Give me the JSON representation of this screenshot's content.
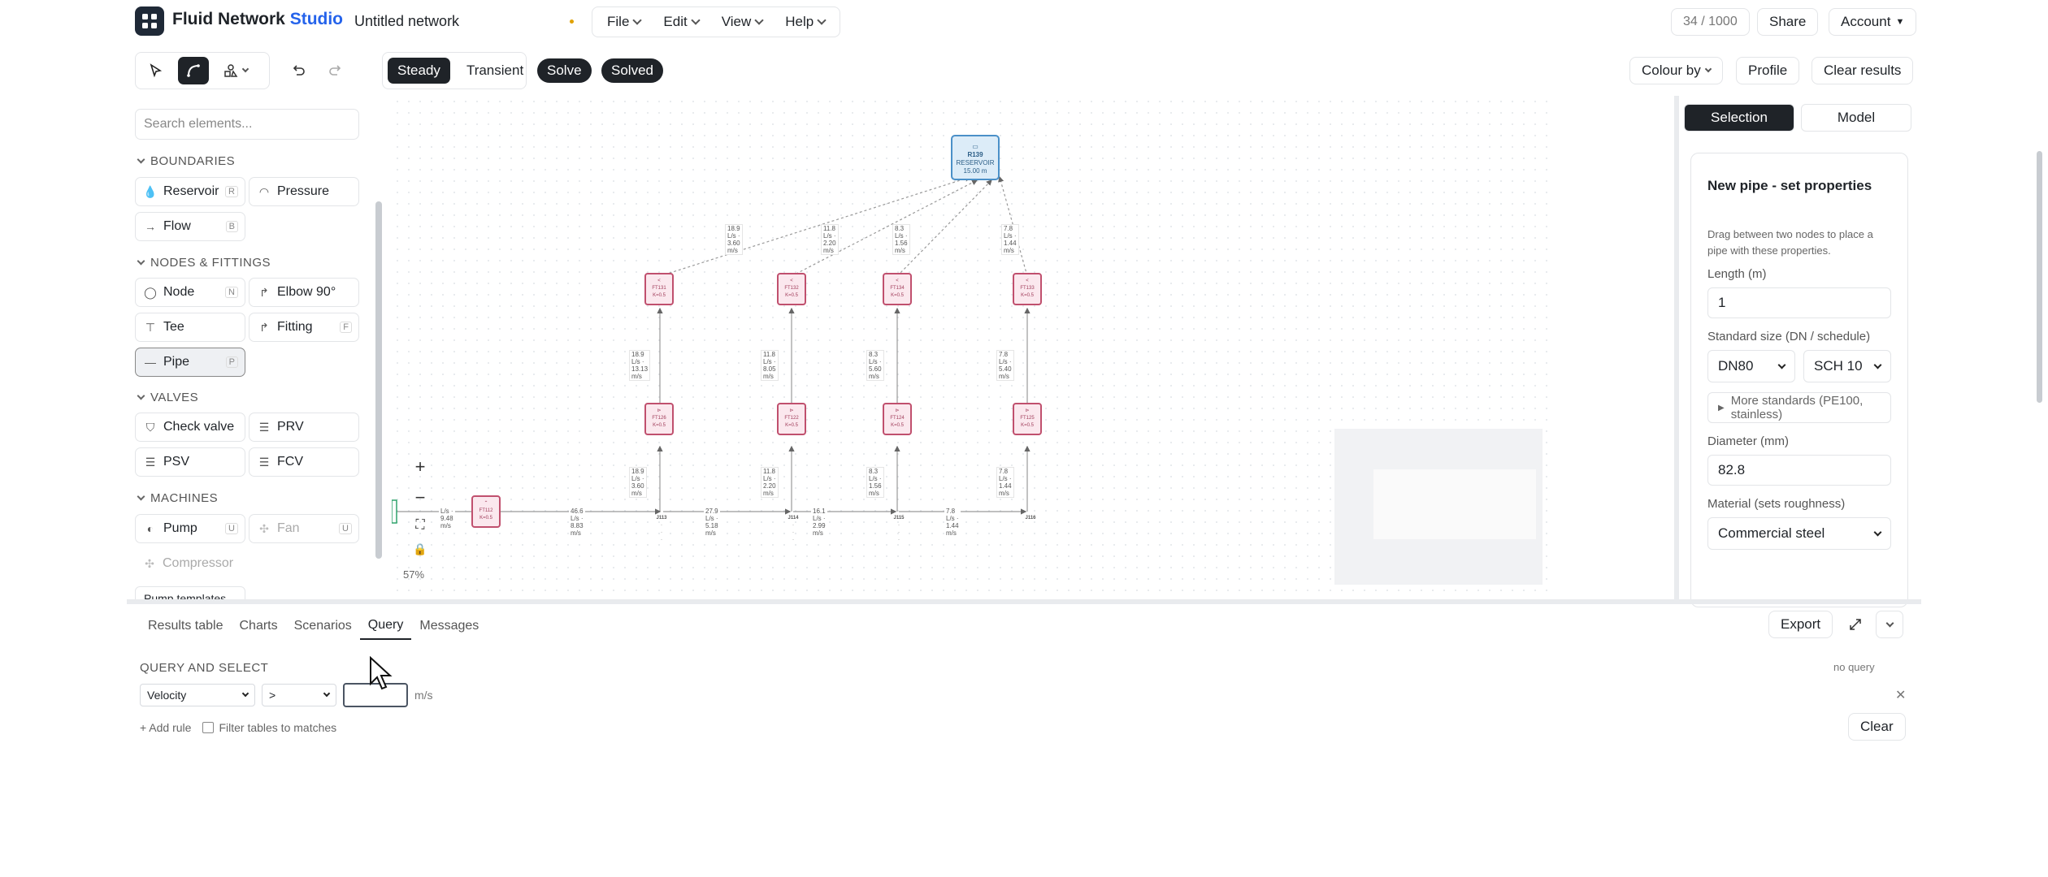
{
  "app": {
    "brand": "Fluid Network",
    "brand_accent": "Studio",
    "document": "Untitled network"
  },
  "menus": [
    {
      "label": "File"
    },
    {
      "label": "Edit"
    },
    {
      "label": "View"
    },
    {
      "label": "Help"
    }
  ],
  "header": {
    "counter": "34 / 1000",
    "share": "Share",
    "account": "Account"
  },
  "toolbar": {
    "steady": "Steady",
    "transient": "Transient",
    "solve": "Solve",
    "status": "Solved",
    "colour_by": "Colour by",
    "profile": "Profile",
    "clear_results": "Clear results"
  },
  "palette": {
    "search_placeholder": "Search elements...",
    "sections": {
      "boundaries": "BOUNDARIES",
      "nodes": "NODES & FITTINGS",
      "valves": "VALVES",
      "machines": "MACHINES"
    },
    "items": {
      "reservoir": {
        "label": "Reservoir",
        "key": "R"
      },
      "pressure": {
        "label": "Pressure"
      },
      "flow": {
        "label": "Flow",
        "key": "B"
      },
      "node": {
        "label": "Node",
        "key": "N"
      },
      "elbow": {
        "label": "Elbow 90°"
      },
      "tee": {
        "label": "Tee"
      },
      "fitting": {
        "label": "Fitting",
        "key": "F"
      },
      "pipe": {
        "label": "Pipe",
        "key": "P"
      },
      "check": {
        "label": "Check valve"
      },
      "prv": {
        "label": "PRV"
      },
      "psv": {
        "label": "PSV"
      },
      "fcv": {
        "label": "FCV"
      },
      "pump": {
        "label": "Pump",
        "key": "U"
      },
      "fan": {
        "label": "Fan",
        "key": "U"
      },
      "compressor": {
        "label": "Compressor"
      },
      "templates": {
        "label": "Pump templates"
      }
    }
  },
  "canvas": {
    "zoom": "57%",
    "reservoir": {
      "id": "R139",
      "type": "RESERVOIR",
      "level": "15.00 m"
    },
    "upper_fittings": [
      {
        "id": "FT131"
      },
      {
        "id": "FT132"
      },
      {
        "id": "FT134"
      },
      {
        "id": "FT133"
      }
    ],
    "lower_fittings": [
      {
        "id": "FT126"
      },
      {
        "id": "FT122"
      },
      {
        "id": "FT124"
      },
      {
        "id": "FT125"
      }
    ],
    "header_fitting": {
      "id": "FT112"
    },
    "junctions": [
      {
        "id": "J113"
      },
      {
        "id": "J114"
      },
      {
        "id": "J115"
      },
      {
        "id": "J116"
      }
    ],
    "fitting_sub": "K=0.5",
    "top_flows": [
      "18.9 L/s · 3.60 m/s",
      "11.8 L/s · 2.20 m/s",
      "8.3 L/s · 1.56 m/s",
      "7.8 L/s · 1.44 m/s"
    ],
    "mid_flows": [
      "18.9 L/s · 13.13 m/s",
      "11.8 L/s · 8.05 m/s",
      "8.3 L/s · 5.60 m/s",
      "7.8 L/s · 5.40 m/s"
    ],
    "low_flows": [
      "18.9 L/s · 3.60 m/s",
      "11.8 L/s · 2.20 m/s",
      "8.3 L/s · 1.56 m/s",
      "7.8 L/s · 1.44 m/s"
    ],
    "header_flows": [
      "L/s · 9.48 m/s",
      "46.6 L/s · 8.83 m/s",
      "27.9 L/s · 5.18 m/s",
      "16.1 L/s · 2.99 m/s",
      "7.8 L/s · 1.44 m/s"
    ]
  },
  "inspector": {
    "tabs": [
      "Selection",
      "Model"
    ],
    "title": "New pipe - set properties",
    "hint": "Drag between two nodes to place a pipe with these properties.",
    "length_label": "Length (m)",
    "length": "1",
    "size_label": "Standard size (DN / schedule)",
    "dn": "DN80",
    "schedule": "SCH 10",
    "more_standards": "More standards (PE100, stainless)",
    "diameter_label": "Diameter (mm)",
    "diameter": "82.8",
    "material_label": "Material (sets roughness)",
    "material": "Commercial steel"
  },
  "bottom": {
    "tabs": [
      "Results table",
      "Charts",
      "Scenarios",
      "Query",
      "Messages"
    ],
    "active_tab": "Query",
    "export": "Export",
    "query_title": "QUERY AND SELECT",
    "no_query": "no query",
    "field": "Velocity",
    "operator": ">",
    "unit": "m/s",
    "add_rule": "+ Add rule",
    "filter_label": "Filter tables to matches",
    "clear": "Clear"
  }
}
